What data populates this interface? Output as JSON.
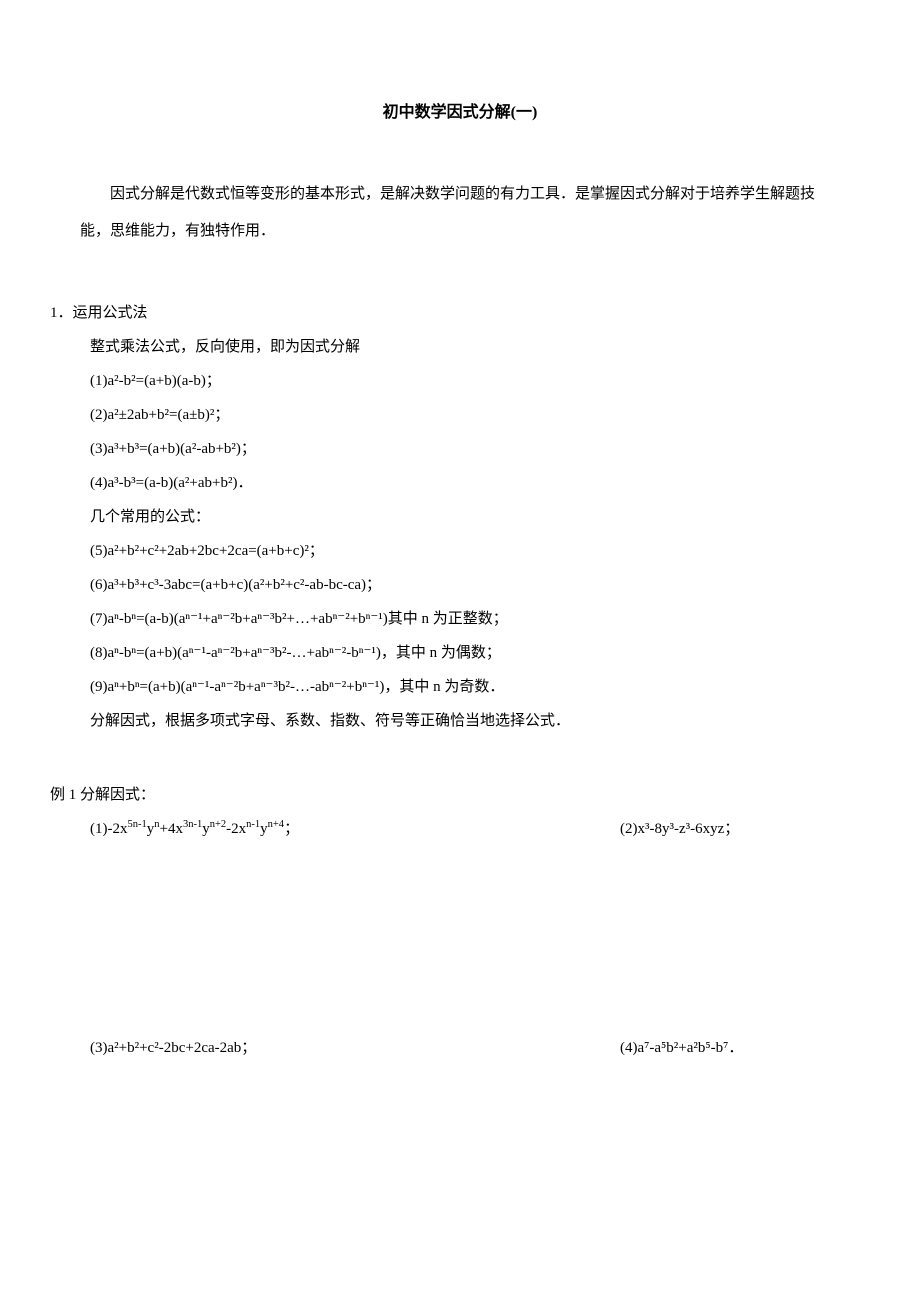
{
  "title": "初中数学因式分解(一)",
  "intro": "因式分解是代数式恒等变形的基本形式，是解决数学问题的有力工具．是掌握因式分解对于培养学生解题技能，思维能力，有独特作用．",
  "section1": {
    "heading": "1．运用公式法",
    "lead": "整式乘法公式，反向使用，即为因式分解",
    "items": [
      "(1)a²-b²=(a+b)(a-b)；",
      "(2)a²±2ab+b²=(a±b)²；",
      "(3)a³+b³=(a+b)(a²-ab+b²)；",
      "(4)a³-b³=(a-b)(a²+ab+b²)．"
    ],
    "sub_heading": "几个常用的公式：",
    "items2": [
      "(5)a²+b²+c²+2ab+2bc+2ca=(a+b+c)²；",
      "(6)a³+b³+c³-3abc=(a+b+c)(a²+b²+c²-ab-bc-ca)；",
      "(7)aⁿ-bⁿ=(a-b)(aⁿ⁻¹+aⁿ⁻²b+aⁿ⁻³b²+…+abⁿ⁻²+bⁿ⁻¹)其中 n 为正整数；",
      "(8)aⁿ-bⁿ=(a+b)(aⁿ⁻¹-aⁿ⁻²b+aⁿ⁻³b²-…+abⁿ⁻²-bⁿ⁻¹)，其中 n 为偶数；",
      "(9)aⁿ+bⁿ=(a+b)(aⁿ⁻¹-aⁿ⁻²b+aⁿ⁻³b²-…-abⁿ⁻²+bⁿ⁻¹)，其中 n 为奇数．"
    ],
    "tail": "分解因式，根据多项式字母、系数、指数、符号等正确恰当地选择公式．"
  },
  "example1": {
    "heading": "例 1 分解因式：",
    "rows": [
      {
        "left_html": "(1)-2x<sup>5n-1</sup>y<sup>n</sup>+4x<sup>3n-1</sup>y<sup>n+2</sup>-2x<sup>n-1</sup>y<sup>n+4</sup>；",
        "right": "(2)x³-8y³-z³-6xyz；"
      },
      {
        "left": "(3)a²+b²+c²-2bc+2ca-2ab；",
        "right": "(4)a⁷-a⁵b²+a²b⁵-b⁷．"
      }
    ]
  }
}
